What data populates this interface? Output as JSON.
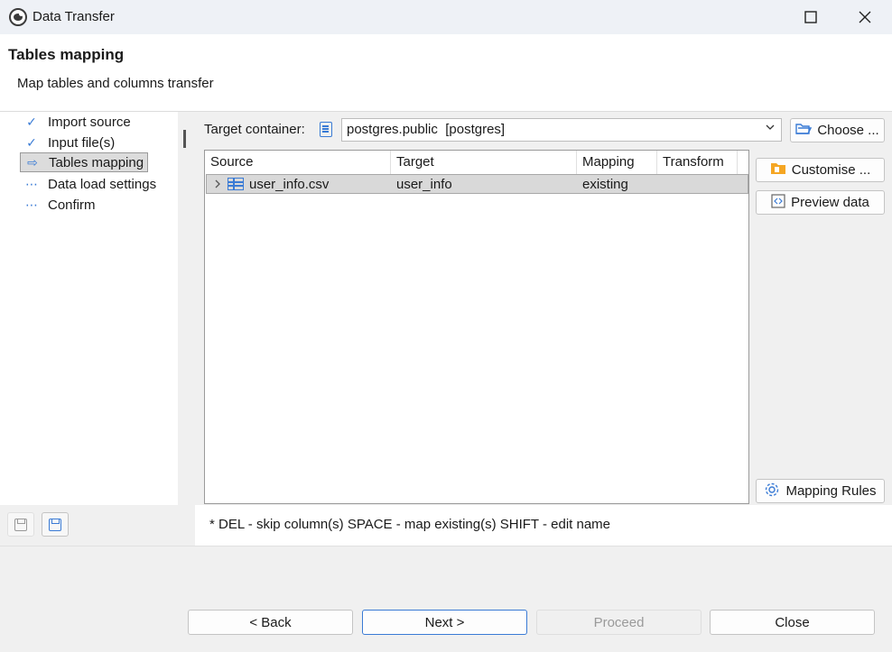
{
  "window": {
    "title": "Data Transfer",
    "maximize_icon": "maximize-icon",
    "close_icon": "close-icon"
  },
  "header": {
    "title": "Tables mapping",
    "description": "Map tables and columns transfer"
  },
  "nav": {
    "items": [
      {
        "label": "Import source",
        "icon": "check-icon",
        "state": "done"
      },
      {
        "label": "Input file(s)",
        "icon": "check-icon",
        "state": "done"
      },
      {
        "label": "Tables mapping",
        "icon": "arrow-right-icon",
        "state": "active"
      },
      {
        "label": "Data load settings",
        "icon": "dots-icon",
        "state": "pending"
      },
      {
        "label": "Confirm",
        "icon": "dots-icon",
        "state": "pending"
      }
    ]
  },
  "target": {
    "label": "Target container:",
    "value": "postgres.public  [postgres]",
    "choose_label": "Choose ..."
  },
  "table": {
    "columns": [
      "Source",
      "Target",
      "Mapping",
      "Transform"
    ],
    "rows": [
      {
        "source": "user_info.csv",
        "target": "user_info",
        "mapping": "existing",
        "transform": ""
      }
    ]
  },
  "side_buttons": {
    "customise": "Customise ...",
    "preview": "Preview data",
    "mapping_rules": "Mapping Rules"
  },
  "hint": "* DEL - skip column(s)  SPACE - map existing(s)  SHIFT - edit name",
  "footer": {
    "back": "< Back",
    "next": "Next >",
    "proceed": "Proceed",
    "close": "Close"
  },
  "colors": {
    "accent": "#3a7bd5",
    "selected_row": "#d9d9d9",
    "folder": "#f5a623"
  }
}
